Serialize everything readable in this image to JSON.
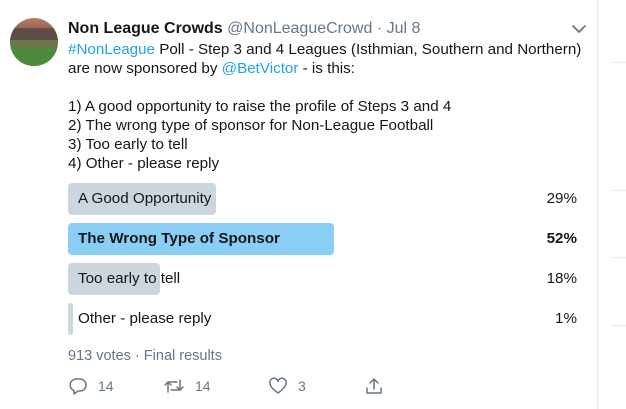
{
  "tweet": {
    "author_name": "Non League Crowds",
    "author_handle": "@NonLeagueCrowd",
    "separator": "·",
    "date": "Jul 8",
    "text": {
      "hashtag": "#NonLeague",
      "line1_rest": " Poll - Step 3 and 4 Leagues (Isthmian, Southern and Northern)",
      "line2_start": "are now sponsored by ",
      "mention": "@BetVictor",
      "line2_end": " - is this:",
      "choices": [
        "1) A good opportunity to raise the profile of Steps 3 and 4",
        "2) The wrong type of sponsor for Non-League Football",
        "3) Too early to tell",
        "4) Other - please reply"
      ]
    }
  },
  "poll": {
    "options": [
      {
        "label": "A Good Opportunity",
        "percent": "29%",
        "fraction": 0.29,
        "winner": false
      },
      {
        "label": "The Wrong Type of Sponsor",
        "percent": "52%",
        "fraction": 0.52,
        "winner": true
      },
      {
        "label": "Too early to tell",
        "percent": "18%",
        "fraction": 0.18,
        "winner": false
      },
      {
        "label": "Other - please reply",
        "percent": "1%",
        "fraction": 0.01,
        "winner": false
      }
    ],
    "votes": "913 votes",
    "separator": "·",
    "status": "Final results"
  },
  "actions": {
    "reply_count": "14",
    "retweet_count": "14",
    "like_count": "3"
  },
  "colors": {
    "bar": "#ccd6dd",
    "bar_winner": "#8bcef5",
    "link": "#1da1f2",
    "muted": "#657786"
  }
}
